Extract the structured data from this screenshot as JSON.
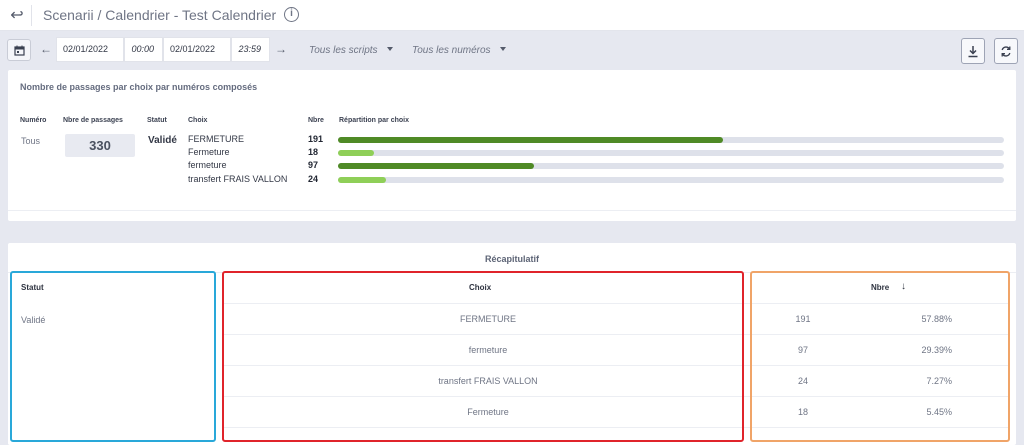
{
  "header": {
    "title": "Scenarii / Calendrier - Test Calendrier",
    "back_icon": "back-arrow-icon",
    "info_icon": "info-icon",
    "info_glyph": "i"
  },
  "toolbar": {
    "calendar_icon": "calendar-icon",
    "prev_arrow": "←",
    "next_arrow": "→",
    "start_date": "02/01/2022",
    "start_time": "00:00",
    "end_date": "02/01/2022",
    "end_time": "23:59",
    "scripts_filter": "Tous les scripts",
    "numbers_filter": "Tous les numéros",
    "download_icon": "download-icon",
    "refresh_icon": "refresh-icon"
  },
  "passages": {
    "heading": "Nombre de passages par choix par numéros composés",
    "columns": {
      "numero": "Numéro",
      "passages": "Nbre de passages",
      "statut": "Statut",
      "choix": "Choix",
      "nbre": "Nbre",
      "repartition": "Répartition par choix"
    },
    "numero": "Tous",
    "total": "330",
    "statut": "Validé",
    "choices": [
      {
        "label": "FERMETURE",
        "count": "191",
        "share": 0.5788
      },
      {
        "label": "Fermeture",
        "count": "18",
        "share": 0.0545
      },
      {
        "label": "fermeture",
        "count": "97",
        "share": 0.2939
      },
      {
        "label": "transfert FRAIS VALLON",
        "count": "24",
        "share": 0.0727
      }
    ]
  },
  "recap": {
    "title": "Récapitulatif",
    "columns": {
      "statut": "Statut",
      "choix": "Choix",
      "nbre": "Nbre"
    },
    "sort_icon": "sort-descending-icon",
    "sort_glyph": "↓",
    "statut": "Validé",
    "rows": [
      {
        "choix": "FERMETURE",
        "nbre": "191",
        "pct": "57.88%"
      },
      {
        "choix": "fermeture",
        "nbre": "97",
        "pct": "29.39%"
      },
      {
        "choix": "transfert FRAIS VALLON",
        "nbre": "24",
        "pct": "7.27%"
      },
      {
        "choix": "Fermeture",
        "nbre": "18",
        "pct": "5.45%"
      }
    ]
  },
  "colors": {
    "dark_green": "#4f8a26",
    "light_green": "#8fcf58",
    "track": "#dee1ea",
    "highlight_blue": "#29a8d9",
    "highlight_red": "#e0242b",
    "highlight_orange": "#f0a468"
  }
}
